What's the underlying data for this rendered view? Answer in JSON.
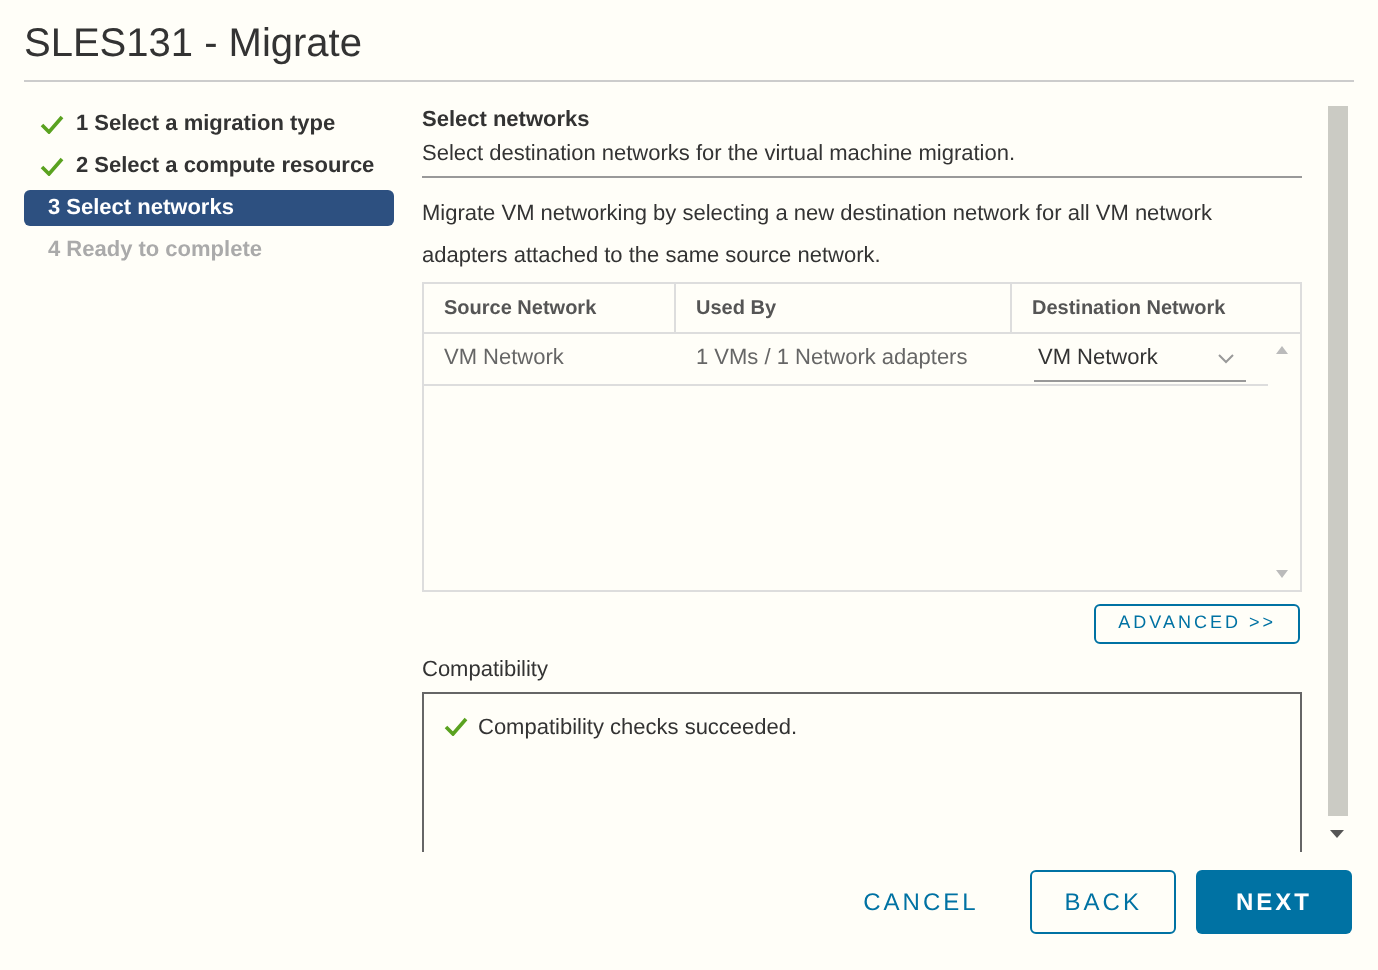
{
  "window": {
    "title": "SLES131 - Migrate"
  },
  "steps": [
    {
      "label": "1 Select a migration type",
      "completed": true,
      "selected": false,
      "disabled": false
    },
    {
      "label": "2 Select a compute resource",
      "completed": true,
      "selected": false,
      "disabled": false
    },
    {
      "label": "3 Select networks",
      "completed": false,
      "selected": true,
      "disabled": false
    },
    {
      "label": "4 Ready to complete",
      "completed": false,
      "selected": false,
      "disabled": true
    }
  ],
  "page": {
    "heading": "Select networks",
    "subheading": "Select destination networks for the virtual machine migration.",
    "description": "Migrate VM networking by selecting a new destination network for all VM network adapters attached to the same source network."
  },
  "table": {
    "columns": [
      "Source Network",
      "Used By",
      "Destination Network"
    ],
    "rows": [
      {
        "source": "VM Network",
        "used_by": "1 VMs / 1 Network adapters",
        "destination": "VM Network"
      }
    ]
  },
  "advanced_button": "ADVANCED >>",
  "compatibility": {
    "label": "Compatibility",
    "message": "Compatibility checks succeeded."
  },
  "buttons": [
    {
      "label": "CANCEL",
      "kind": "link"
    },
    {
      "label": "BACK",
      "kind": "outline"
    },
    {
      "label": "NEXT",
      "kind": "primary"
    }
  ]
}
